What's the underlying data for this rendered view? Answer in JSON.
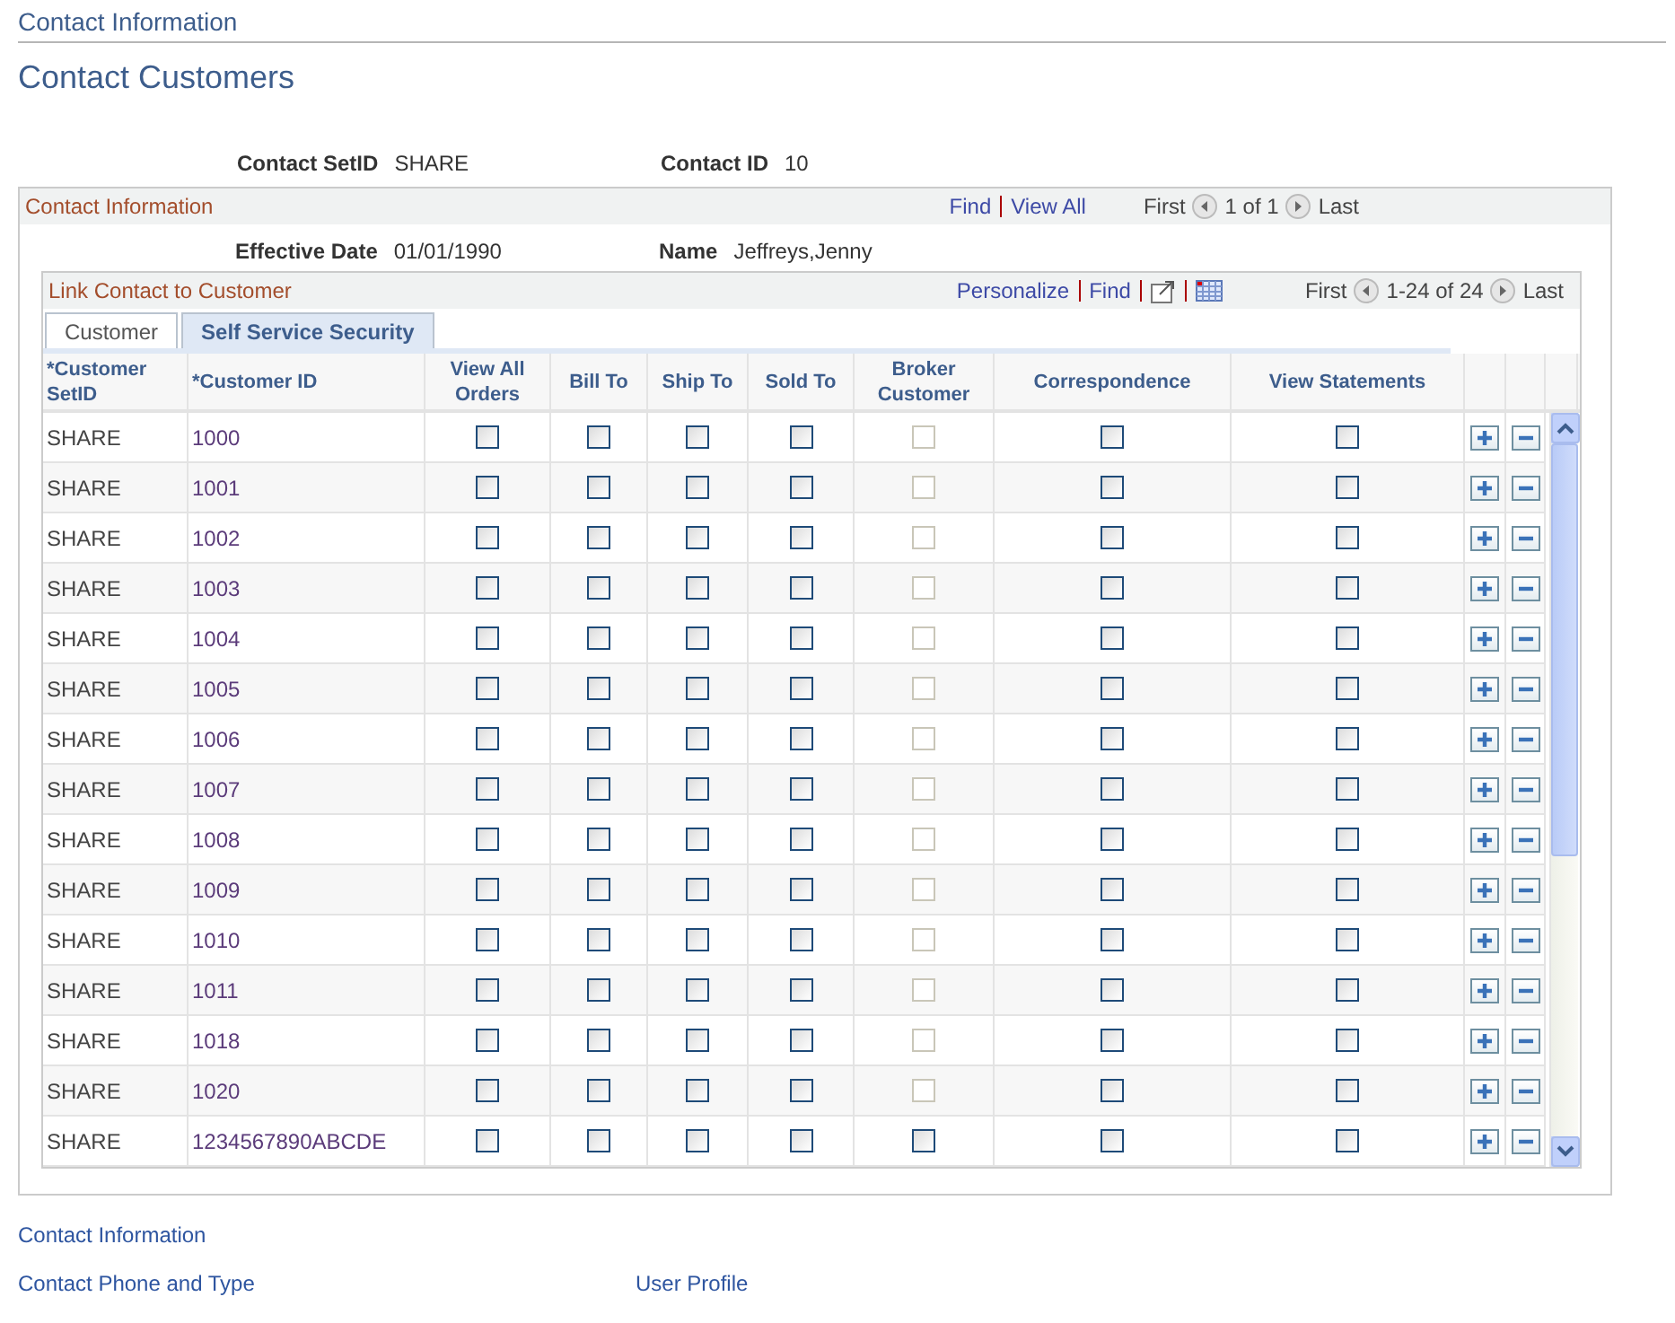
{
  "breadcrumb": "Contact Information",
  "page_title": "Contact Customers",
  "header_fields": [
    {
      "label": "Contact SetID",
      "value": "SHARE"
    },
    {
      "label": "Contact ID",
      "value": "10"
    }
  ],
  "contact_section": {
    "title": "Contact Information",
    "links": [
      "Find",
      "View All"
    ],
    "nav": {
      "first": "First",
      "count": "1 of 1",
      "last": "Last"
    },
    "fields": [
      {
        "label": "Effective Date",
        "value": "01/01/1990"
      },
      {
        "label": "Name",
        "value": "Jeffreys,Jenny"
      }
    ]
  },
  "grid": {
    "title": "Link Contact to Customer",
    "links": [
      "Personalize",
      "Find"
    ],
    "nav": {
      "first": "First",
      "count": "1-24 of 24",
      "last": "Last"
    },
    "tabs": [
      {
        "label": "Customer",
        "selected": false
      },
      {
        "label": "Self Service Security",
        "selected": true
      }
    ],
    "columns": [
      "*Customer SetID",
      "*Customer ID",
      "View All Orders",
      "Bill To",
      "Ship To",
      "Sold To",
      "Broker Customer",
      "Correspondence",
      "View Statements"
    ],
    "rows": [
      {
        "setid": "SHARE",
        "customer_id": "1000",
        "checks": [
          {
            "checked": false,
            "disabled": false
          },
          {
            "checked": false,
            "disabled": false
          },
          {
            "checked": false,
            "disabled": false
          },
          {
            "checked": false,
            "disabled": false
          },
          {
            "checked": false,
            "disabled": true
          },
          {
            "checked": false,
            "disabled": false
          },
          {
            "checked": false,
            "disabled": false
          }
        ]
      },
      {
        "setid": "SHARE",
        "customer_id": "1001",
        "checks": [
          {
            "checked": false,
            "disabled": false
          },
          {
            "checked": false,
            "disabled": false
          },
          {
            "checked": false,
            "disabled": false
          },
          {
            "checked": false,
            "disabled": false
          },
          {
            "checked": false,
            "disabled": true
          },
          {
            "checked": false,
            "disabled": false
          },
          {
            "checked": false,
            "disabled": false
          }
        ]
      },
      {
        "setid": "SHARE",
        "customer_id": "1002",
        "checks": [
          {
            "checked": false,
            "disabled": false
          },
          {
            "checked": false,
            "disabled": false
          },
          {
            "checked": false,
            "disabled": false
          },
          {
            "checked": false,
            "disabled": false
          },
          {
            "checked": false,
            "disabled": true
          },
          {
            "checked": false,
            "disabled": false
          },
          {
            "checked": false,
            "disabled": false
          }
        ]
      },
      {
        "setid": "SHARE",
        "customer_id": "1003",
        "checks": [
          {
            "checked": false,
            "disabled": false
          },
          {
            "checked": false,
            "disabled": false
          },
          {
            "checked": false,
            "disabled": false
          },
          {
            "checked": false,
            "disabled": false
          },
          {
            "checked": false,
            "disabled": true
          },
          {
            "checked": false,
            "disabled": false
          },
          {
            "checked": false,
            "disabled": false
          }
        ]
      },
      {
        "setid": "SHARE",
        "customer_id": "1004",
        "checks": [
          {
            "checked": false,
            "disabled": false
          },
          {
            "checked": false,
            "disabled": false
          },
          {
            "checked": false,
            "disabled": false
          },
          {
            "checked": false,
            "disabled": false
          },
          {
            "checked": false,
            "disabled": true
          },
          {
            "checked": false,
            "disabled": false
          },
          {
            "checked": false,
            "disabled": false
          }
        ]
      },
      {
        "setid": "SHARE",
        "customer_id": "1005",
        "checks": [
          {
            "checked": false,
            "disabled": false
          },
          {
            "checked": false,
            "disabled": false
          },
          {
            "checked": false,
            "disabled": false
          },
          {
            "checked": false,
            "disabled": false
          },
          {
            "checked": false,
            "disabled": true
          },
          {
            "checked": false,
            "disabled": false
          },
          {
            "checked": false,
            "disabled": false
          }
        ]
      },
      {
        "setid": "SHARE",
        "customer_id": "1006",
        "checks": [
          {
            "checked": false,
            "disabled": false
          },
          {
            "checked": false,
            "disabled": false
          },
          {
            "checked": false,
            "disabled": false
          },
          {
            "checked": false,
            "disabled": false
          },
          {
            "checked": false,
            "disabled": true
          },
          {
            "checked": false,
            "disabled": false
          },
          {
            "checked": false,
            "disabled": false
          }
        ]
      },
      {
        "setid": "SHARE",
        "customer_id": "1007",
        "checks": [
          {
            "checked": false,
            "disabled": false
          },
          {
            "checked": false,
            "disabled": false
          },
          {
            "checked": false,
            "disabled": false
          },
          {
            "checked": false,
            "disabled": false
          },
          {
            "checked": false,
            "disabled": true
          },
          {
            "checked": false,
            "disabled": false
          },
          {
            "checked": false,
            "disabled": false
          }
        ]
      },
      {
        "setid": "SHARE",
        "customer_id": "1008",
        "checks": [
          {
            "checked": false,
            "disabled": false
          },
          {
            "checked": false,
            "disabled": false
          },
          {
            "checked": false,
            "disabled": false
          },
          {
            "checked": false,
            "disabled": false
          },
          {
            "checked": false,
            "disabled": true
          },
          {
            "checked": false,
            "disabled": false
          },
          {
            "checked": false,
            "disabled": false
          }
        ]
      },
      {
        "setid": "SHARE",
        "customer_id": "1009",
        "checks": [
          {
            "checked": false,
            "disabled": false
          },
          {
            "checked": false,
            "disabled": false
          },
          {
            "checked": false,
            "disabled": false
          },
          {
            "checked": false,
            "disabled": false
          },
          {
            "checked": false,
            "disabled": true
          },
          {
            "checked": false,
            "disabled": false
          },
          {
            "checked": false,
            "disabled": false
          }
        ]
      },
      {
        "setid": "SHARE",
        "customer_id": "1010",
        "checks": [
          {
            "checked": false,
            "disabled": false
          },
          {
            "checked": false,
            "disabled": false
          },
          {
            "checked": false,
            "disabled": false
          },
          {
            "checked": false,
            "disabled": false
          },
          {
            "checked": false,
            "disabled": true
          },
          {
            "checked": false,
            "disabled": false
          },
          {
            "checked": false,
            "disabled": false
          }
        ]
      },
      {
        "setid": "SHARE",
        "customer_id": "1011",
        "checks": [
          {
            "checked": false,
            "disabled": false
          },
          {
            "checked": false,
            "disabled": false
          },
          {
            "checked": false,
            "disabled": false
          },
          {
            "checked": false,
            "disabled": false
          },
          {
            "checked": false,
            "disabled": true
          },
          {
            "checked": false,
            "disabled": false
          },
          {
            "checked": false,
            "disabled": false
          }
        ]
      },
      {
        "setid": "SHARE",
        "customer_id": "1018",
        "checks": [
          {
            "checked": false,
            "disabled": false
          },
          {
            "checked": false,
            "disabled": false
          },
          {
            "checked": false,
            "disabled": false
          },
          {
            "checked": false,
            "disabled": false
          },
          {
            "checked": false,
            "disabled": true
          },
          {
            "checked": false,
            "disabled": false
          },
          {
            "checked": false,
            "disabled": false
          }
        ]
      },
      {
        "setid": "SHARE",
        "customer_id": "1020",
        "checks": [
          {
            "checked": false,
            "disabled": false
          },
          {
            "checked": false,
            "disabled": false
          },
          {
            "checked": false,
            "disabled": false
          },
          {
            "checked": false,
            "disabled": false
          },
          {
            "checked": false,
            "disabled": true
          },
          {
            "checked": false,
            "disabled": false
          },
          {
            "checked": false,
            "disabled": false
          }
        ]
      },
      {
        "setid": "SHARE",
        "customer_id": "1234567890ABCDE",
        "checks": [
          {
            "checked": false,
            "disabled": false
          },
          {
            "checked": false,
            "disabled": false
          },
          {
            "checked": false,
            "disabled": false
          },
          {
            "checked": false,
            "disabled": false
          },
          {
            "checked": false,
            "disabled": false
          },
          {
            "checked": false,
            "disabled": false
          },
          {
            "checked": false,
            "disabled": false
          }
        ]
      }
    ]
  },
  "footer_links": [
    {
      "label": "Contact Information"
    },
    {
      "label": "Contact Phone and Type"
    },
    {
      "label": "User Profile"
    }
  ]
}
